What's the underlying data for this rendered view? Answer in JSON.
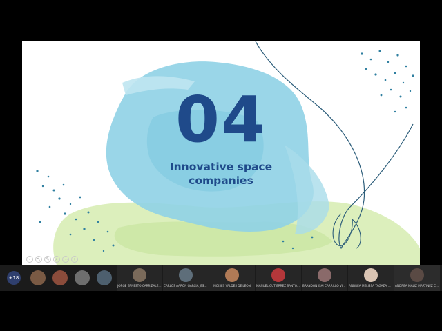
{
  "slide": {
    "number": "04",
    "subtitle_line1": "Innovative space",
    "subtitle_line2": "companies",
    "colors": {
      "navy": "#1f4a8a",
      "blue_wash": "#86cfe4",
      "light_blue": "#c2e8f2",
      "green_wash": "#cfe8a6",
      "dot": "#2f7fa0",
      "line": "#2c5d7a"
    },
    "toolbar_icons": [
      "prev-icon",
      "pointer-icon",
      "pen-icon",
      "zoom-icon",
      "options-icon",
      "next-icon"
    ]
  },
  "meeting": {
    "overflow_count": "+18",
    "small_tiles": [
      {
        "initial": "",
        "color": "#7a5a44"
      },
      {
        "initial": "",
        "color": "#8b4c3b"
      },
      {
        "initial": "",
        "color": "#6e6e6e"
      },
      {
        "initial": "",
        "color": "#4d5f6e"
      }
    ],
    "tiles": [
      {
        "name": "JORGE ERNESTO CARRIZALES SAN...",
        "color": "#7a6a5a"
      },
      {
        "name": "CARLOS AARON GARCIA JESÚS",
        "color": "#5e6e7a"
      },
      {
        "name": "MOISES VALDES DE LEON",
        "color": "#b07a56"
      },
      {
        "name": "MANUEL GUTIERREZ SANTOYO",
        "color": "#b4373a"
      },
      {
        "name": "BRANDON ISAI CARRILLO VILLANU...",
        "color": "#8a6a6a"
      },
      {
        "name": "ANDREA MELISSA TAGAZA GONZA...",
        "color": "#d9c4b3"
      },
      {
        "name": "ANDREA MALIZ MARTINEZ CORTES",
        "color": "#5a4a44"
      }
    ]
  }
}
